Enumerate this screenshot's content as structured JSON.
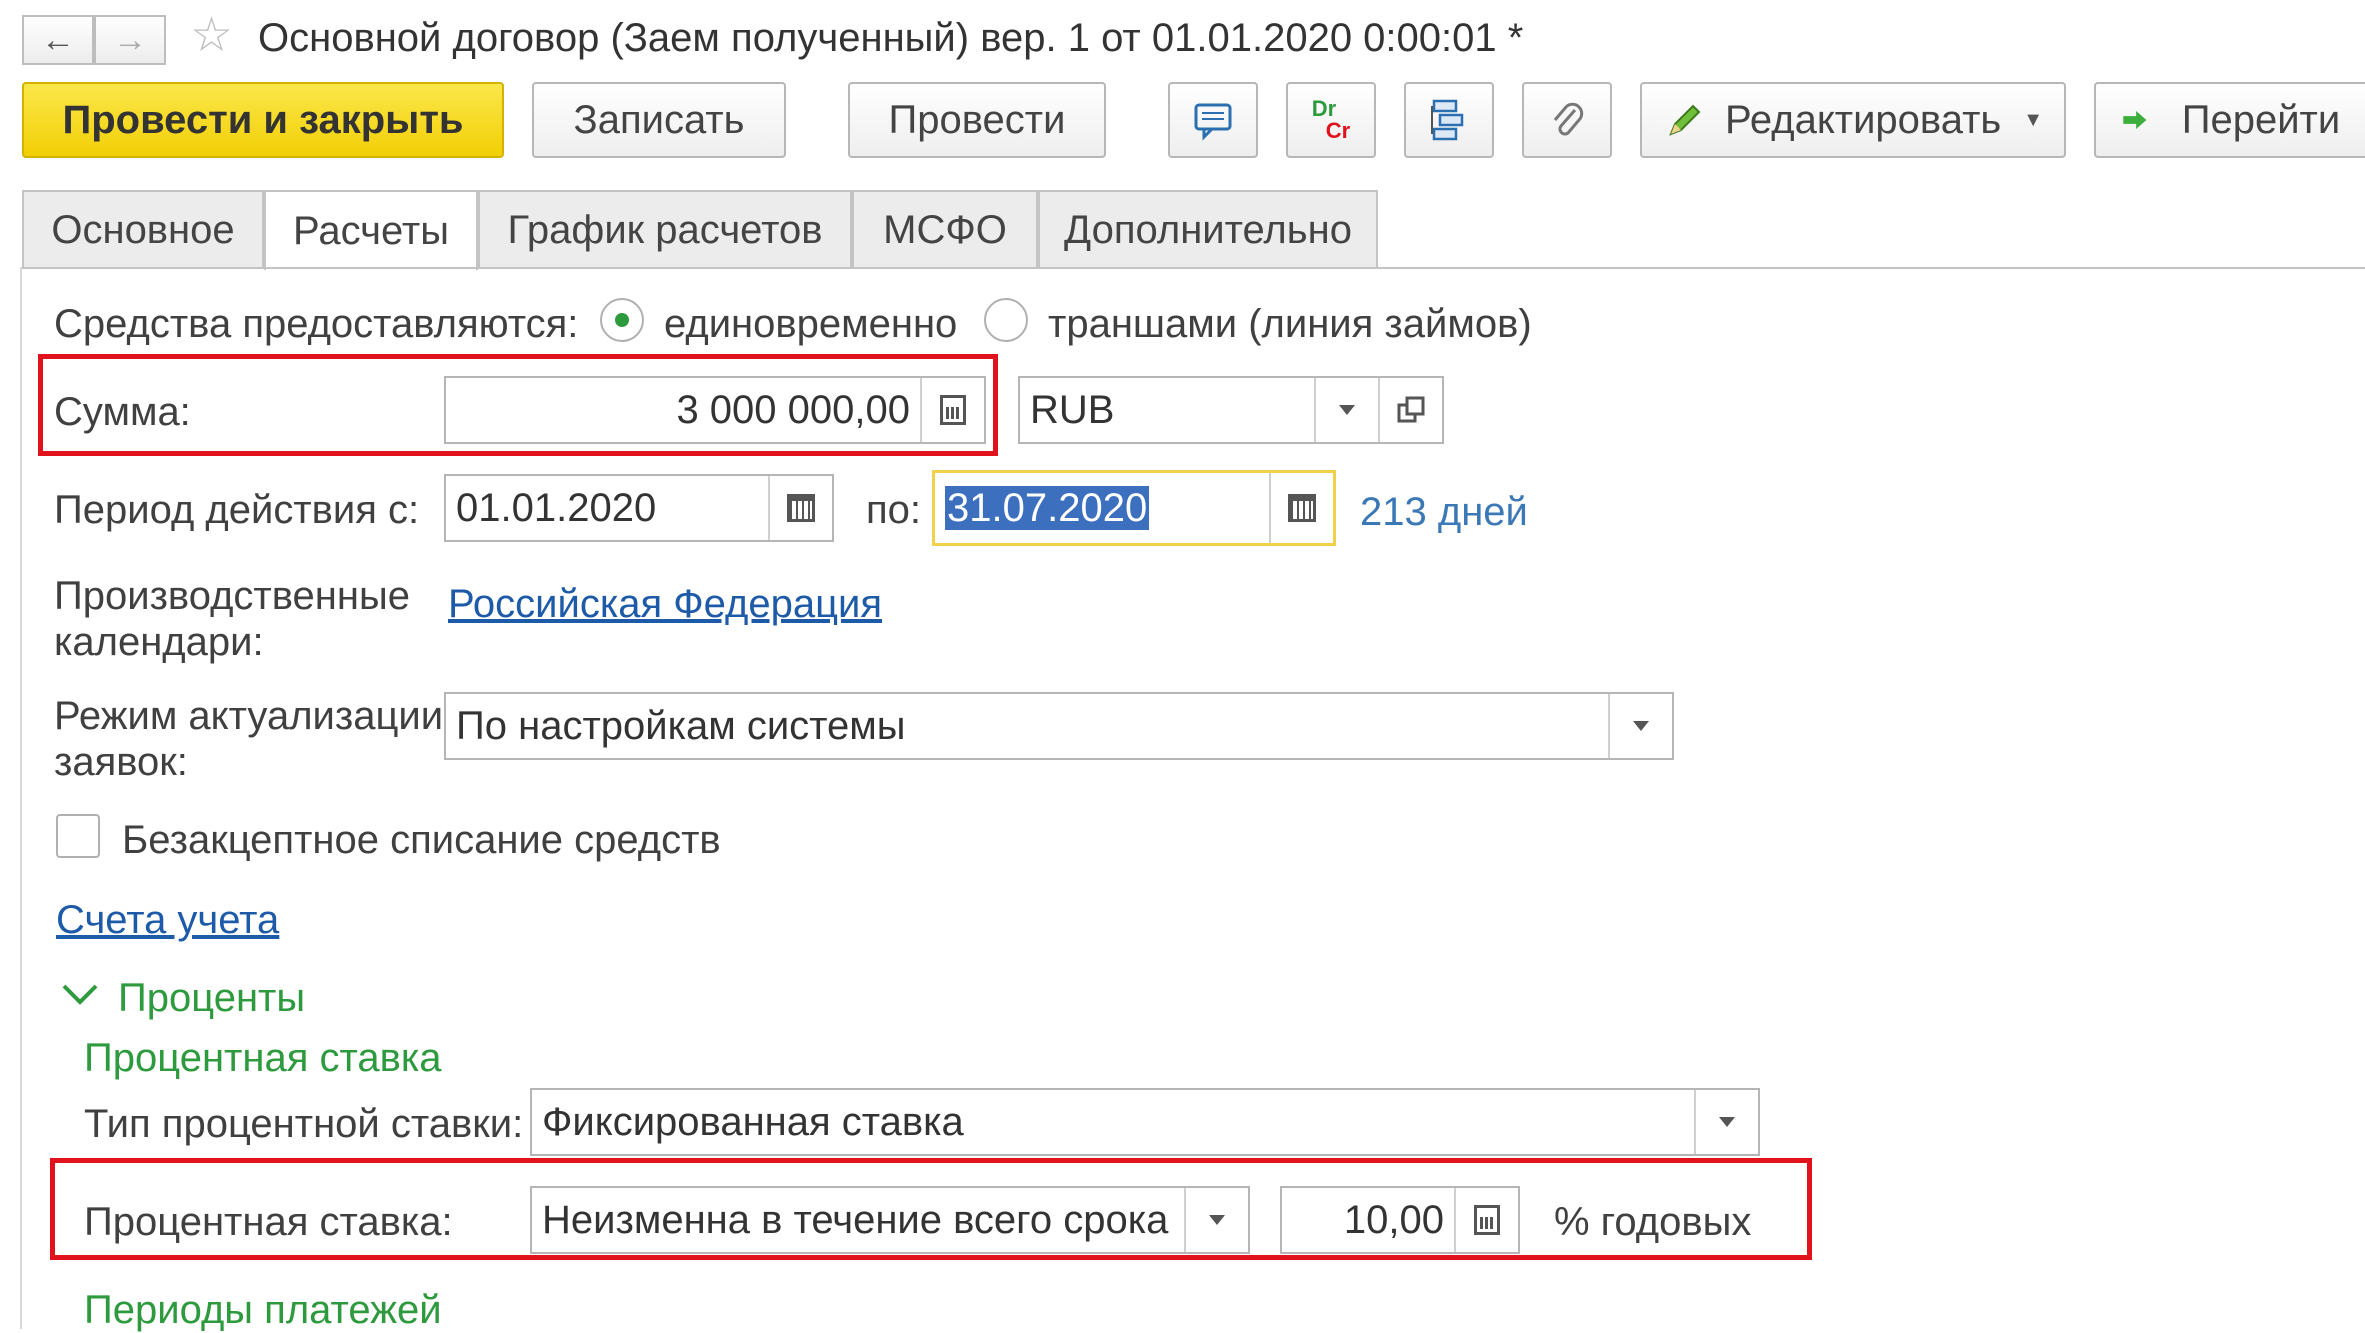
{
  "window": {
    "title": "Основной договор (Заем полученный) вер. 1 от 01.01.2020 0:00:01 *"
  },
  "toolbar": {
    "post_and_close": "Провести и закрыть",
    "save": "Записать",
    "post": "Провести",
    "edit": "Редактировать",
    "goto": "Перейти",
    "dr": "Dr",
    "cr": "Cr"
  },
  "tabs": [
    {
      "label": "Основное"
    },
    {
      "label": "Расчеты"
    },
    {
      "label": "График расчетов"
    },
    {
      "label": "МСФО"
    },
    {
      "label": "Дополнительно"
    }
  ],
  "form": {
    "funds_label": "Средства предоставляются:",
    "funds_option_once": "единовременно",
    "funds_option_tranches": "траншами (линия займов)",
    "sum_label": "Сумма:",
    "sum_value": "3 000 000,00",
    "currency_value": "RUB",
    "period_label": "Период действия с:",
    "period_from": "01.01.2020",
    "period_to_label": "по:",
    "period_to": "31.07.2020",
    "period_days": "213 дней",
    "calendars_label_line1": "Производственные",
    "calendars_label_line2": "календари:",
    "calendars_link": "Российская Федерация",
    "mode_label_line1": "Режим актуализации",
    "mode_label_line2": "заявок:",
    "mode_value": "По настройкам системы",
    "acceptless_label": "Безакцептное списание средств",
    "accounts_link": "Счета учета",
    "interest_section": "Проценты",
    "interest_rate_group": "Процентная ставка",
    "rate_type_label": "Тип процентной ставки:",
    "rate_type_value": "Фиксированная ставка",
    "rate_label": "Процентная ставка:",
    "rate_mode_value": "Неизменна в течение всего срока",
    "rate_value": "10,00",
    "rate_unit": "% годовых",
    "payment_periods": "Периоды платежей"
  },
  "colors": {
    "accent_yellow": "#f2cf06",
    "highlight_red": "#e0121b",
    "link_blue": "#1d5aa7",
    "group_green": "#2e9a3e"
  }
}
